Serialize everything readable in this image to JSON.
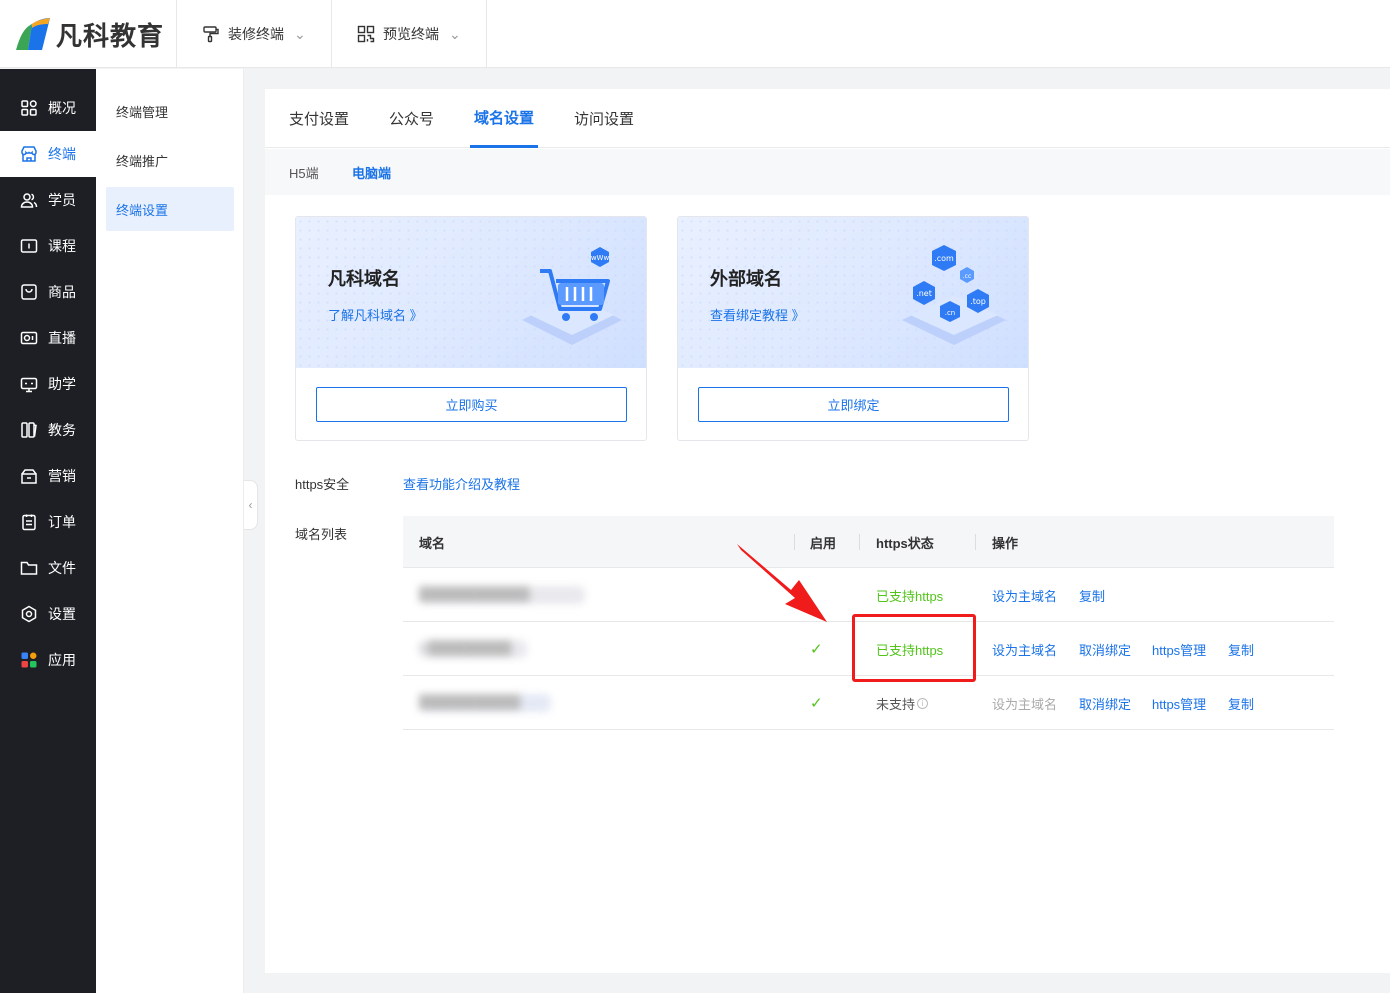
{
  "brand": {
    "name": "凡科教育"
  },
  "topbar": {
    "menus": [
      {
        "label": "装修终端",
        "icon": "paint-roller-icon"
      },
      {
        "label": "预览终端",
        "icon": "qrcode-icon"
      }
    ]
  },
  "sidebar": {
    "items": [
      {
        "label": "概况",
        "icon": "grid-icon"
      },
      {
        "label": "终端",
        "icon": "store-icon",
        "active": true
      },
      {
        "label": "学员",
        "icon": "users-icon"
      },
      {
        "label": "课程",
        "icon": "course-icon"
      },
      {
        "label": "商品",
        "icon": "goods-icon"
      },
      {
        "label": "直播",
        "icon": "live-icon"
      },
      {
        "label": "助学",
        "icon": "assist-icon"
      },
      {
        "label": "教务",
        "icon": "book-icon"
      },
      {
        "label": "营销",
        "icon": "marketing-icon"
      },
      {
        "label": "订单",
        "icon": "order-icon"
      },
      {
        "label": "文件",
        "icon": "folder-icon"
      },
      {
        "label": "设置",
        "icon": "gear-icon"
      },
      {
        "label": "应用",
        "icon": "apps-icon"
      }
    ]
  },
  "subnav": {
    "items": [
      {
        "label": "终端管理"
      },
      {
        "label": "终端推广"
      },
      {
        "label": "终端设置",
        "active": true
      }
    ]
  },
  "tabs": [
    {
      "label": "支付设置"
    },
    {
      "label": "公众号"
    },
    {
      "label": "域名设置",
      "active": true
    },
    {
      "label": "访问设置"
    }
  ],
  "subtabs": [
    {
      "label": "H5端"
    },
    {
      "label": "电脑端",
      "active": true
    }
  ],
  "cards": [
    {
      "title": "凡科域名",
      "link": "了解凡科域名 》",
      "button": "立即购买"
    },
    {
      "title": "外部域名",
      "link": "查看绑定教程 》",
      "button": "立即绑定"
    }
  ],
  "https_section": {
    "label": "https安全",
    "link": "查看功能介绍及教程"
  },
  "domain_list": {
    "label": "域名列表",
    "columns": [
      "域名",
      "启用",
      "https状态",
      "操作"
    ],
    "rows": [
      {
        "domain": "████████████",
        "enabled": "",
        "https": "已支持https",
        "https_status": "ok",
        "actions": [
          "设为主域名",
          "复制"
        ]
      },
      {
        "domain": "w█████████",
        "enabled": "✓",
        "https": "已支持https",
        "https_status": "ok",
        "actions": [
          "设为主域名",
          "取消绑定",
          "https管理",
          "复制"
        ]
      },
      {
        "domain": "███████████",
        "enabled": "✓",
        "https": "未支持",
        "https_status": "none",
        "actions": [
          "设为主域名",
          "取消绑定",
          "https管理",
          "复制"
        ]
      }
    ]
  },
  "colors": {
    "accent": "#1a73e8",
    "success": "#52c41a",
    "sidebar_bg": "#1d1f24",
    "annotation": "#f01b1b"
  }
}
